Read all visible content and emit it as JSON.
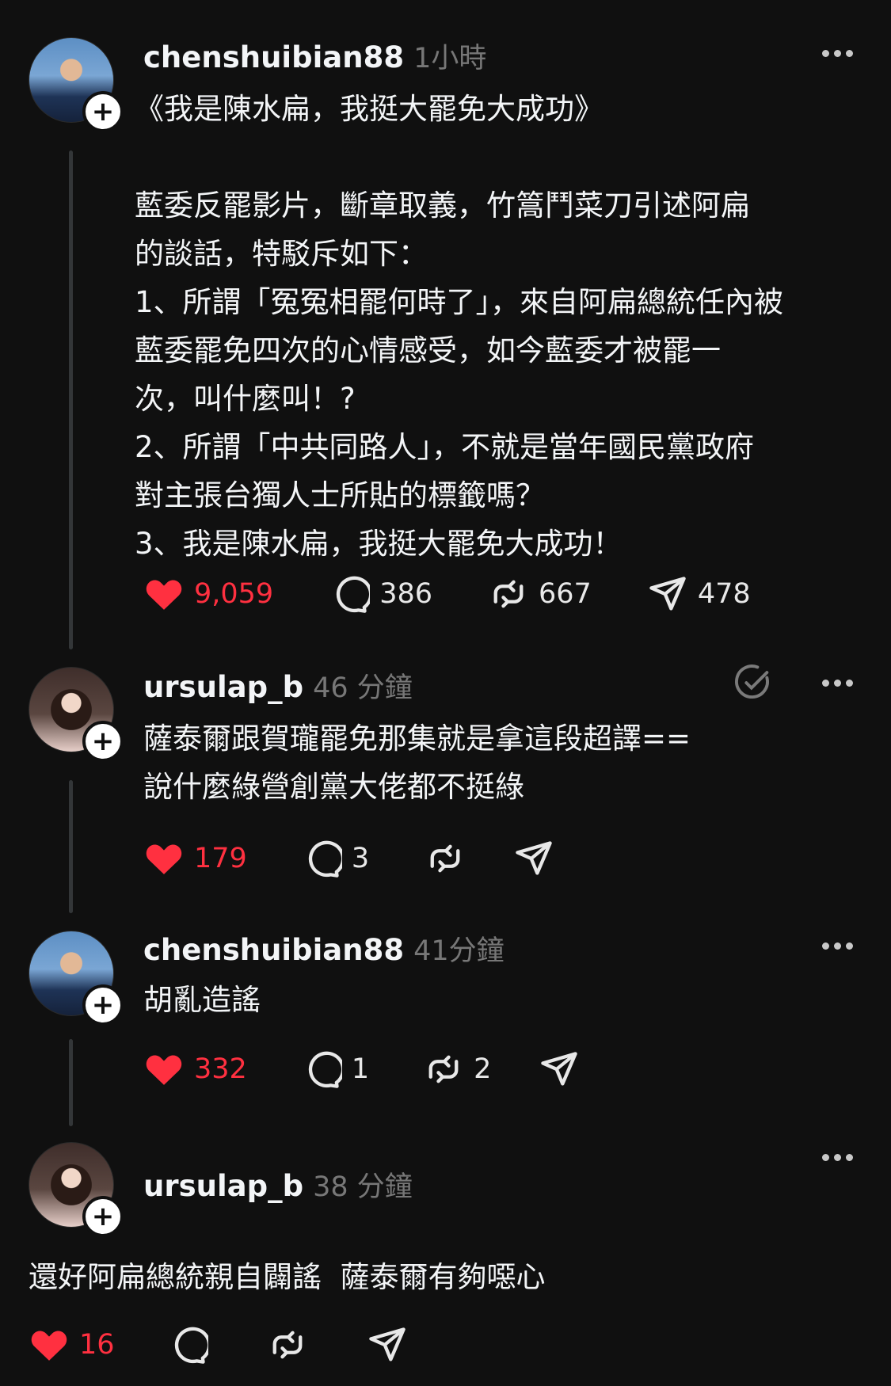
{
  "posts": [
    {
      "username": "chenshuibian88",
      "time": "1小時",
      "text": "《我是陳水扁，我挺大罷免大成功》\n\n藍委反罷影片，斷章取義，竹篙鬥菜刀引述阿扁\n的談話，特駁斥如下：\n1、所謂「冤冤相罷何時了」，來自阿扁總統任內被\n藍委罷免四次的心情感受，如今藍委才被罷一\n次，叫什麼叫！?\n2、所謂「中共同路人」，不就是當年國民黨政府\n對主張台獨人士所貼的標籤嗎？\n3、我是陳水扁，我挺大罷免大成功！",
      "likes": "9,059",
      "comments": "386",
      "reposts": "667",
      "shares": "478"
    },
    {
      "username": "ursulap_b",
      "time": "46 分鐘",
      "text": "薩泰爾跟賀瓏罷免那集就是拿這段超譯==\n說什麼綠營創黨大佬都不挺綠",
      "likes": "179",
      "comments": "3"
    },
    {
      "username": "chenshuibian88",
      "time": "41分鐘",
      "text": "胡亂造謠",
      "likes": "332",
      "comments": "1",
      "reposts": "2"
    },
    {
      "username": "ursulap_b",
      "time": "38 分鐘",
      "text": "還好阿扁總統親自闢謠  薩泰爾有夠噁心",
      "likes": "16"
    }
  ],
  "icons": {
    "like": "heart-icon",
    "comment": "comment-icon",
    "repost": "repost-icon",
    "share": "share-icon",
    "more": "more-icon",
    "translate": "translate-icon",
    "follow": "plus-icon"
  },
  "colors": {
    "background": "#101010",
    "like_red": "#ff3040",
    "muted_gray": "#777777"
  }
}
